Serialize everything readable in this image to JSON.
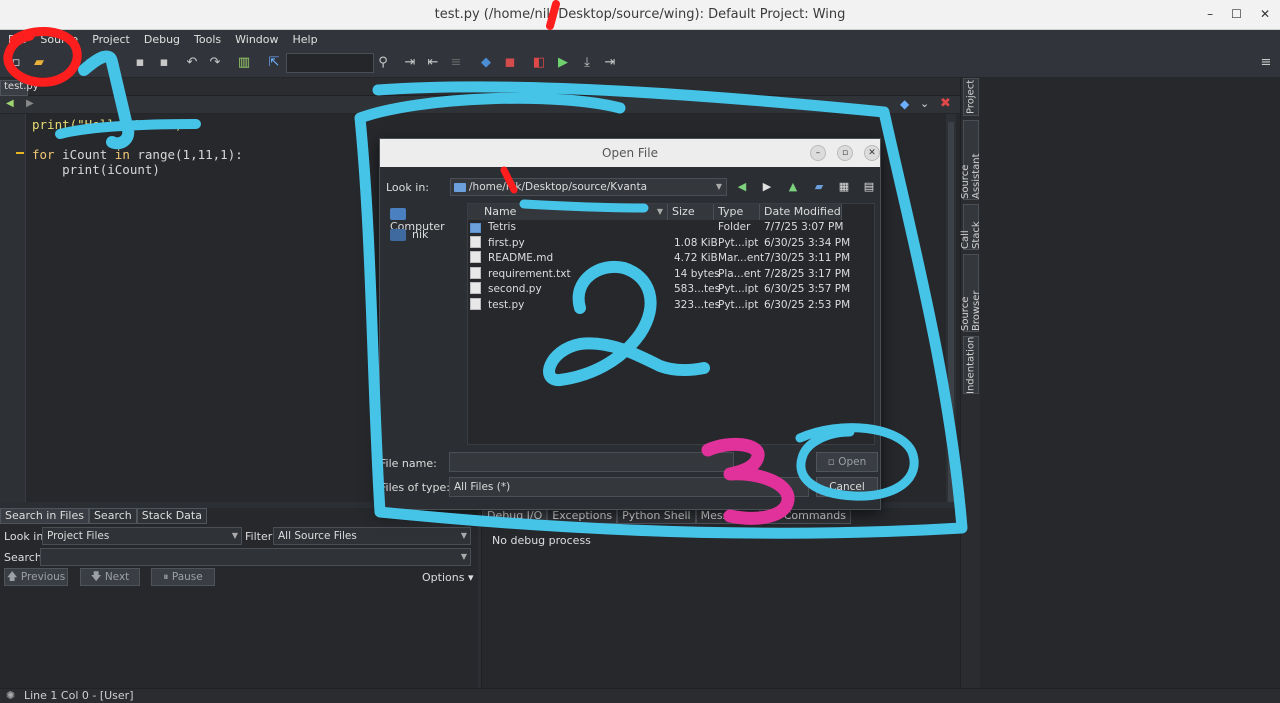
{
  "window": {
    "title": "test.py (/home/nik/Desktop/source/wing): Default Project: Wing",
    "minimize": "–",
    "maximize": "☐",
    "close": "✕"
  },
  "menu": [
    "File",
    "Source",
    "Project",
    "Debug",
    "Tools",
    "Window",
    "Help"
  ],
  "editor": {
    "tab_label": "test.py",
    "code_lines": [
      {
        "parts": [
          {
            "t": "print(",
            "c": "fn"
          },
          {
            "t": "\"Hello World\"",
            "c": "str"
          },
          {
            "t": ")",
            "c": "fn"
          }
        ]
      },
      {
        "parts": [
          {
            "t": "",
            "c": "plain"
          }
        ]
      },
      {
        "parts": [
          {
            "t": "for",
            "c": "kw"
          },
          {
            "t": " iCount ",
            "c": "plain"
          },
          {
            "t": "in",
            "c": "kw"
          },
          {
            "t": " range(1,11,1):",
            "c": "plain"
          }
        ]
      },
      {
        "parts": [
          {
            "t": "    print(iCount)",
            "c": "plain"
          }
        ]
      }
    ]
  },
  "right_tabs": [
    "Project",
    "Source Assistant",
    "Call Stack",
    "Source Browser",
    "Indentation"
  ],
  "search_panel": {
    "tabs": [
      "Search in Files",
      "Search",
      "Stack Data"
    ],
    "look_in_label": "Look in:",
    "look_in_value": "Project Files",
    "filter_label": "Filter:",
    "filter_value": "All Source Files",
    "search_label": "Search:",
    "previous": "Previous",
    "next": "Next",
    "pause": "Pause",
    "options": "Options"
  },
  "debug_panel": {
    "tabs": [
      "Debug I/O",
      "Exceptions",
      "Python Shell",
      "Messages",
      "OS Commands"
    ],
    "message": "No debug process"
  },
  "status": {
    "text": "Line 1 Col 0 - [User]"
  },
  "dialog": {
    "title": "Open File",
    "look_in_label": "Look in:",
    "path": "/home/nik/Desktop/source/Kvanta",
    "places": [
      "Computer",
      "nik"
    ],
    "columns": [
      "Name",
      "Size",
      "Type",
      "Date Modified"
    ],
    "files": [
      {
        "name": "Tetris",
        "size": "",
        "type": "Folder",
        "date": "7/7/25 3:07 PM",
        "dir": true
      },
      {
        "name": "first.py",
        "size": "1.08 KiB",
        "type": "Pyt...ipt",
        "date": "6/30/25 3:34 PM",
        "dir": false
      },
      {
        "name": "README.md",
        "size": "4.72 KiB",
        "type": "Mar...ent",
        "date": "7/30/25 3:11 PM",
        "dir": false
      },
      {
        "name": "requirement.txt",
        "size": "14 bytes",
        "type": "Pla...ent",
        "date": "7/28/25 3:17 PM",
        "dir": false
      },
      {
        "name": "second.py",
        "size": "583...tes",
        "type": "Pyt...ipt",
        "date": "6/30/25 3:57 PM",
        "dir": false
      },
      {
        "name": "test.py",
        "size": "323...tes",
        "type": "Pyt...ipt",
        "date": "6/30/25 2:53 PM",
        "dir": false
      }
    ],
    "file_name_label": "File name:",
    "files_of_type_label": "Files of type:",
    "files_of_type_value": "All Files (*)",
    "open_label": "Open",
    "cancel_label": "Cancel"
  },
  "annotations": [
    "1",
    "2",
    "3"
  ]
}
